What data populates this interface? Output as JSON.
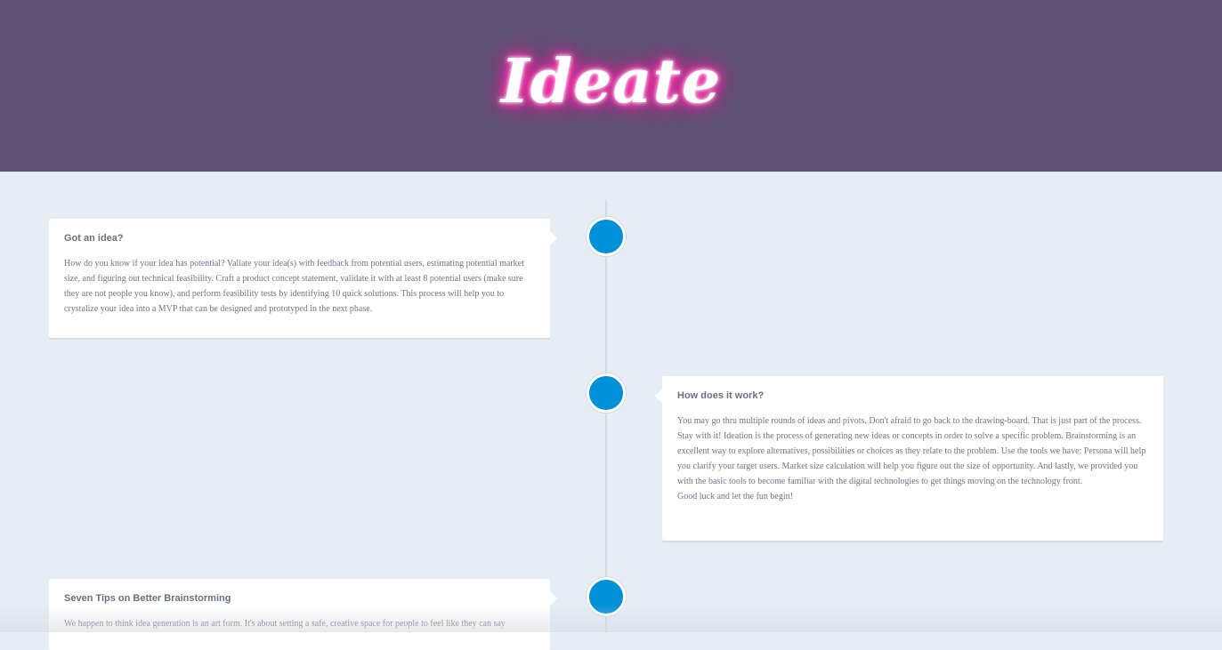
{
  "header": {
    "brand_title": "Ideate",
    "background_color": "#5e5173",
    "glow_color": "#ff2aa8"
  },
  "timeline": {
    "accent_color": "#0091d9",
    "items": [
      {
        "title": "Got an idea?",
        "body": "How do you know if your idea has potential? Valiate your idea(s) with feedback from potential users, estimating potential market size, and figuring out technical feasibility. Craft a product concept statement, validate it with at least 8 potential users (make sure they are not people you know), and perform feasibility tests by identifying 10 quick solutions. This process will help you to crystalize your idea into a MVP that can be designed and prototyped in the next phase."
      },
      {
        "title": "How does it work?",
        "body": "You may go thru multiple rounds of ideas and pivots. Don't afraid to go back to the drawing-board. That is just part of the process. Stay with it! Ideation is the process of generating new ideas or concepts in order to solve a specific problem. Brainstorming is an excellent way to explore alternatives, possibilities or choices as they relate to the problem. Use the tools we have: Persona will help you clarify your target users. Market size calculation will help you figure out the size of opportunity. And lastly, we provided you with the basic tools to become familiar with the digital technologies to get things moving on the technology front.\nGood luck and let the fun begin!"
      },
      {
        "title": "Seven Tips on Better Brainstorming",
        "body": "We happen to think idea generation is an art form. It's about setting a safe, creative space for people to feel like they can say"
      }
    ]
  }
}
